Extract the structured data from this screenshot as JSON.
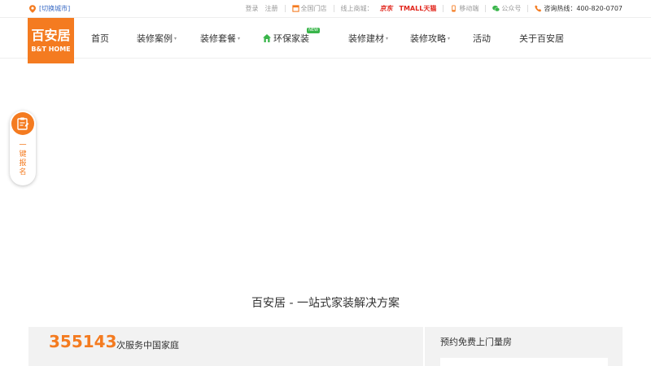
{
  "topbar": {
    "city_switch": "[切换城市]",
    "login": "登录",
    "register": "注册",
    "stores": "全国门店",
    "online_mall": "线上商城：",
    "jd": "京东",
    "tmall": "TMALL天猫",
    "mobile": "移动端",
    "wechat": "公众号",
    "hotline": "咨询热线：400-820-0707"
  },
  "logo": {
    "cn": "百安居",
    "en": "B&T HOME"
  },
  "nav": {
    "items": [
      {
        "label": "首页"
      },
      {
        "label": "装修案例"
      },
      {
        "label": "装修套餐"
      },
      {
        "label": "环保家装",
        "badge": "NEW"
      },
      {
        "label": "装修建材"
      },
      {
        "label": "装修攻略"
      },
      {
        "label": "活动"
      },
      {
        "label": "关于百安居"
      }
    ]
  },
  "side_widget": {
    "label": "一键报名"
  },
  "section": {
    "title": "百安居 - 一站式家装解决方案"
  },
  "stats": {
    "families_served": "355143",
    "families_label": "次服务中国家庭"
  },
  "booking": {
    "title": "预约免费上门量房"
  },
  "colors": {
    "brand_orange": "#f47b20",
    "tmall_red": "#e1251b",
    "eco_green": "#39b54a",
    "link_blue": "#3a6bc5"
  }
}
